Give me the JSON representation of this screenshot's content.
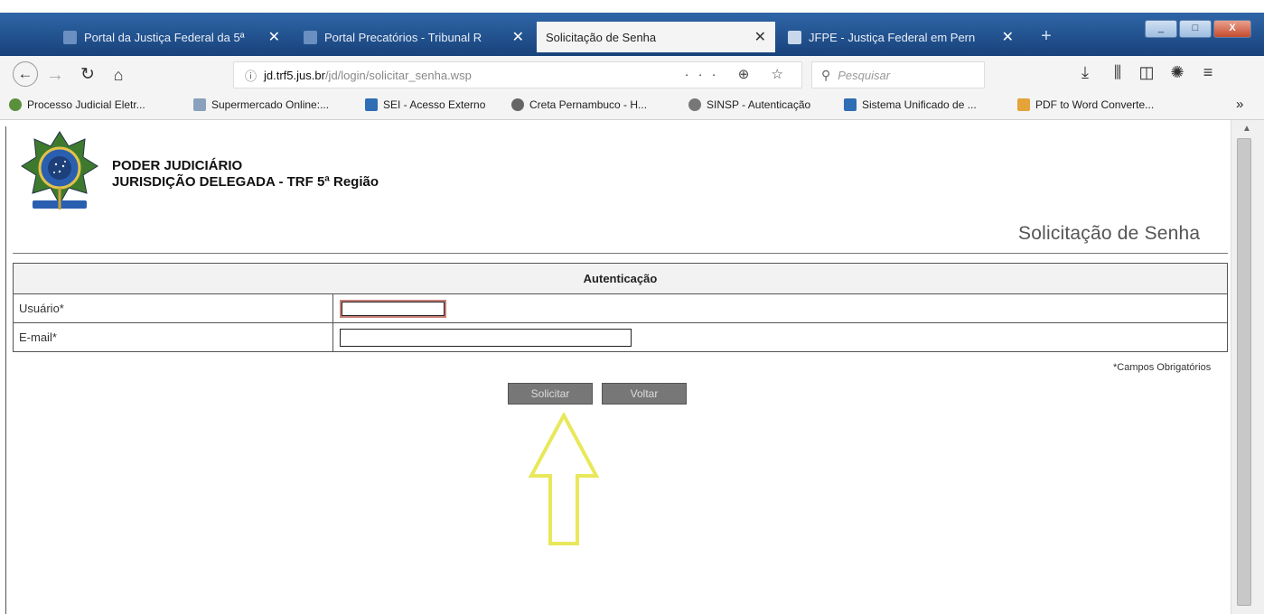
{
  "browser": {
    "tabs": [
      {
        "label": "Portal da Justiça Federal da 5ª",
        "favicon_color": "#6b8fc0",
        "active": false
      },
      {
        "label": "Portal Precatórios - Tribunal R",
        "favicon_color": "#6b8fc0",
        "active": false
      },
      {
        "label": "Solicitação de Senha",
        "favicon_color": "",
        "active": true
      },
      {
        "label": "JFPE - Justiça Federal em Pern",
        "favicon_color": "#c9d7ea",
        "active": false
      }
    ],
    "new_tab": "+",
    "window_buttons": {
      "minimize": "_",
      "maximize": "□",
      "close": "X"
    },
    "url_host": "jd.trf5.jus.br",
    "url_path": "/jd/login/solicitar_senha.wsp",
    "url_actions": "··· ⊕ ☆",
    "search_placeholder": "Pesquisar",
    "bookmarks": [
      {
        "label": "Processo Judicial Eletr...",
        "color": "#5a8f3c"
      },
      {
        "label": "Supermercado Online:...",
        "color": "#8aa1bd"
      },
      {
        "label": "SEI - Acesso Externo",
        "color": "#2f6db5"
      },
      {
        "label": "Creta Pernambuco - H...",
        "color": "#666"
      },
      {
        "label": "SINSP - Autenticação",
        "color": "#777"
      },
      {
        "label": "Sistema Unificado de ...",
        "color": "#2f6db5"
      },
      {
        "label": "PDF to Word Converte...",
        "color": "#e4a43a"
      }
    ],
    "bookmarks_more": "»"
  },
  "header": {
    "org_line1": "PODER JUDICIÁRIO",
    "org_line2": "JURISDIÇÃO DELEGADA - TRF 5ª Região"
  },
  "page_title": "Solicitação de Senha",
  "form": {
    "section_title": "Autenticação",
    "user_label": "Usuário*",
    "user_value": "",
    "email_label": "E-mail*",
    "email_value": "",
    "required_note": "*Campos Obrigatórios",
    "submit_label": "Solicitar",
    "back_label": "Voltar"
  },
  "colors": {
    "annotation_arrow": "#e8e85a",
    "button_bg": "#777777"
  }
}
